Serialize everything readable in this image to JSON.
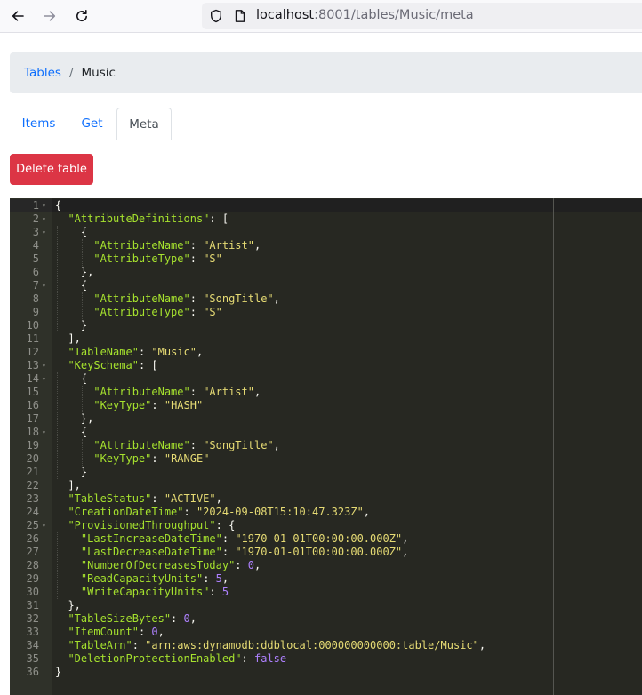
{
  "browser": {
    "url_host": "localhost",
    "url_path": ":8001/tables/Music/meta"
  },
  "breadcrumb": {
    "root": "Tables",
    "separator": "/",
    "current": "Music"
  },
  "tabs": [
    {
      "label": "Items",
      "active": false
    },
    {
      "label": "Get",
      "active": false
    },
    {
      "label": "Meta",
      "active": true
    }
  ],
  "actions": {
    "delete_label": "Delete table"
  },
  "editor": {
    "lines": [
      [
        {
          "t": "{",
          "c": "p"
        }
      ],
      [
        {
          "t": "  ",
          "c": "p"
        },
        {
          "t": "\"AttributeDefinitions\"",
          "c": "k"
        },
        {
          "t": ": [",
          "c": "p"
        }
      ],
      [
        {
          "t": "    {",
          "c": "p"
        }
      ],
      [
        {
          "t": "      ",
          "c": "p"
        },
        {
          "t": "\"AttributeName\"",
          "c": "k"
        },
        {
          "t": ": ",
          "c": "p"
        },
        {
          "t": "\"Artist\"",
          "c": "s"
        },
        {
          "t": ",",
          "c": "p"
        }
      ],
      [
        {
          "t": "      ",
          "c": "p"
        },
        {
          "t": "\"AttributeType\"",
          "c": "k"
        },
        {
          "t": ": ",
          "c": "p"
        },
        {
          "t": "\"S\"",
          "c": "s"
        }
      ],
      [
        {
          "t": "    },",
          "c": "p"
        }
      ],
      [
        {
          "t": "    {",
          "c": "p"
        }
      ],
      [
        {
          "t": "      ",
          "c": "p"
        },
        {
          "t": "\"AttributeName\"",
          "c": "k"
        },
        {
          "t": ": ",
          "c": "p"
        },
        {
          "t": "\"SongTitle\"",
          "c": "s"
        },
        {
          "t": ",",
          "c": "p"
        }
      ],
      [
        {
          "t": "      ",
          "c": "p"
        },
        {
          "t": "\"AttributeType\"",
          "c": "k"
        },
        {
          "t": ": ",
          "c": "p"
        },
        {
          "t": "\"S\"",
          "c": "s"
        }
      ],
      [
        {
          "t": "    }",
          "c": "p"
        }
      ],
      [
        {
          "t": "  ],",
          "c": "p"
        }
      ],
      [
        {
          "t": "  ",
          "c": "p"
        },
        {
          "t": "\"TableName\"",
          "c": "k"
        },
        {
          "t": ": ",
          "c": "p"
        },
        {
          "t": "\"Music\"",
          "c": "s"
        },
        {
          "t": ",",
          "c": "p"
        }
      ],
      [
        {
          "t": "  ",
          "c": "p"
        },
        {
          "t": "\"KeySchema\"",
          "c": "k"
        },
        {
          "t": ": [",
          "c": "p"
        }
      ],
      [
        {
          "t": "    {",
          "c": "p"
        }
      ],
      [
        {
          "t": "      ",
          "c": "p"
        },
        {
          "t": "\"AttributeName\"",
          "c": "k"
        },
        {
          "t": ": ",
          "c": "p"
        },
        {
          "t": "\"Artist\"",
          "c": "s"
        },
        {
          "t": ",",
          "c": "p"
        }
      ],
      [
        {
          "t": "      ",
          "c": "p"
        },
        {
          "t": "\"KeyType\"",
          "c": "k"
        },
        {
          "t": ": ",
          "c": "p"
        },
        {
          "t": "\"HASH\"",
          "c": "s"
        }
      ],
      [
        {
          "t": "    },",
          "c": "p"
        }
      ],
      [
        {
          "t": "    {",
          "c": "p"
        }
      ],
      [
        {
          "t": "      ",
          "c": "p"
        },
        {
          "t": "\"AttributeName\"",
          "c": "k"
        },
        {
          "t": ": ",
          "c": "p"
        },
        {
          "t": "\"SongTitle\"",
          "c": "s"
        },
        {
          "t": ",",
          "c": "p"
        }
      ],
      [
        {
          "t": "      ",
          "c": "p"
        },
        {
          "t": "\"KeyType\"",
          "c": "k"
        },
        {
          "t": ": ",
          "c": "p"
        },
        {
          "t": "\"RANGE\"",
          "c": "s"
        }
      ],
      [
        {
          "t": "    }",
          "c": "p"
        }
      ],
      [
        {
          "t": "  ],",
          "c": "p"
        }
      ],
      [
        {
          "t": "  ",
          "c": "p"
        },
        {
          "t": "\"TableStatus\"",
          "c": "k"
        },
        {
          "t": ": ",
          "c": "p"
        },
        {
          "t": "\"ACTIVE\"",
          "c": "s"
        },
        {
          "t": ",",
          "c": "p"
        }
      ],
      [
        {
          "t": "  ",
          "c": "p"
        },
        {
          "t": "\"CreationDateTime\"",
          "c": "k"
        },
        {
          "t": ": ",
          "c": "p"
        },
        {
          "t": "\"2024-09-08T15:10:47.323Z\"",
          "c": "s"
        },
        {
          "t": ",",
          "c": "p"
        }
      ],
      [
        {
          "t": "  ",
          "c": "p"
        },
        {
          "t": "\"ProvisionedThroughput\"",
          "c": "k"
        },
        {
          "t": ": {",
          "c": "p"
        }
      ],
      [
        {
          "t": "    ",
          "c": "p"
        },
        {
          "t": "\"LastIncreaseDateTime\"",
          "c": "k"
        },
        {
          "t": ": ",
          "c": "p"
        },
        {
          "t": "\"1970-01-01T00:00:00.000Z\"",
          "c": "s"
        },
        {
          "t": ",",
          "c": "p"
        }
      ],
      [
        {
          "t": "    ",
          "c": "p"
        },
        {
          "t": "\"LastDecreaseDateTime\"",
          "c": "k"
        },
        {
          "t": ": ",
          "c": "p"
        },
        {
          "t": "\"1970-01-01T00:00:00.000Z\"",
          "c": "s"
        },
        {
          "t": ",",
          "c": "p"
        }
      ],
      [
        {
          "t": "    ",
          "c": "p"
        },
        {
          "t": "\"NumberOfDecreasesToday\"",
          "c": "k"
        },
        {
          "t": ": ",
          "c": "p"
        },
        {
          "t": "0",
          "c": "n"
        },
        {
          "t": ",",
          "c": "p"
        }
      ],
      [
        {
          "t": "    ",
          "c": "p"
        },
        {
          "t": "\"ReadCapacityUnits\"",
          "c": "k"
        },
        {
          "t": ": ",
          "c": "p"
        },
        {
          "t": "5",
          "c": "n"
        },
        {
          "t": ",",
          "c": "p"
        }
      ],
      [
        {
          "t": "    ",
          "c": "p"
        },
        {
          "t": "\"WriteCapacityUnits\"",
          "c": "k"
        },
        {
          "t": ": ",
          "c": "p"
        },
        {
          "t": "5",
          "c": "n"
        }
      ],
      [
        {
          "t": "  },",
          "c": "p"
        }
      ],
      [
        {
          "t": "  ",
          "c": "p"
        },
        {
          "t": "\"TableSizeBytes\"",
          "c": "k"
        },
        {
          "t": ": ",
          "c": "p"
        },
        {
          "t": "0",
          "c": "n"
        },
        {
          "t": ",",
          "c": "p"
        }
      ],
      [
        {
          "t": "  ",
          "c": "p"
        },
        {
          "t": "\"ItemCount\"",
          "c": "k"
        },
        {
          "t": ": ",
          "c": "p"
        },
        {
          "t": "0",
          "c": "n"
        },
        {
          "t": ",",
          "c": "p"
        }
      ],
      [
        {
          "t": "  ",
          "c": "p"
        },
        {
          "t": "\"TableArn\"",
          "c": "k"
        },
        {
          "t": ": ",
          "c": "p"
        },
        {
          "t": "\"arn:aws:dynamodb:ddblocal:000000000000:table/Music\"",
          "c": "s"
        },
        {
          "t": ",",
          "c": "p"
        }
      ],
      [
        {
          "t": "  ",
          "c": "p"
        },
        {
          "t": "\"DeletionProtectionEnabled\"",
          "c": "k"
        },
        {
          "t": ": ",
          "c": "p"
        },
        {
          "t": "false",
          "c": "n"
        }
      ],
      [
        {
          "t": "}",
          "c": "p"
        }
      ]
    ],
    "fold_lines": [
      1,
      2,
      3,
      7,
      13,
      14,
      18,
      25
    ]
  }
}
